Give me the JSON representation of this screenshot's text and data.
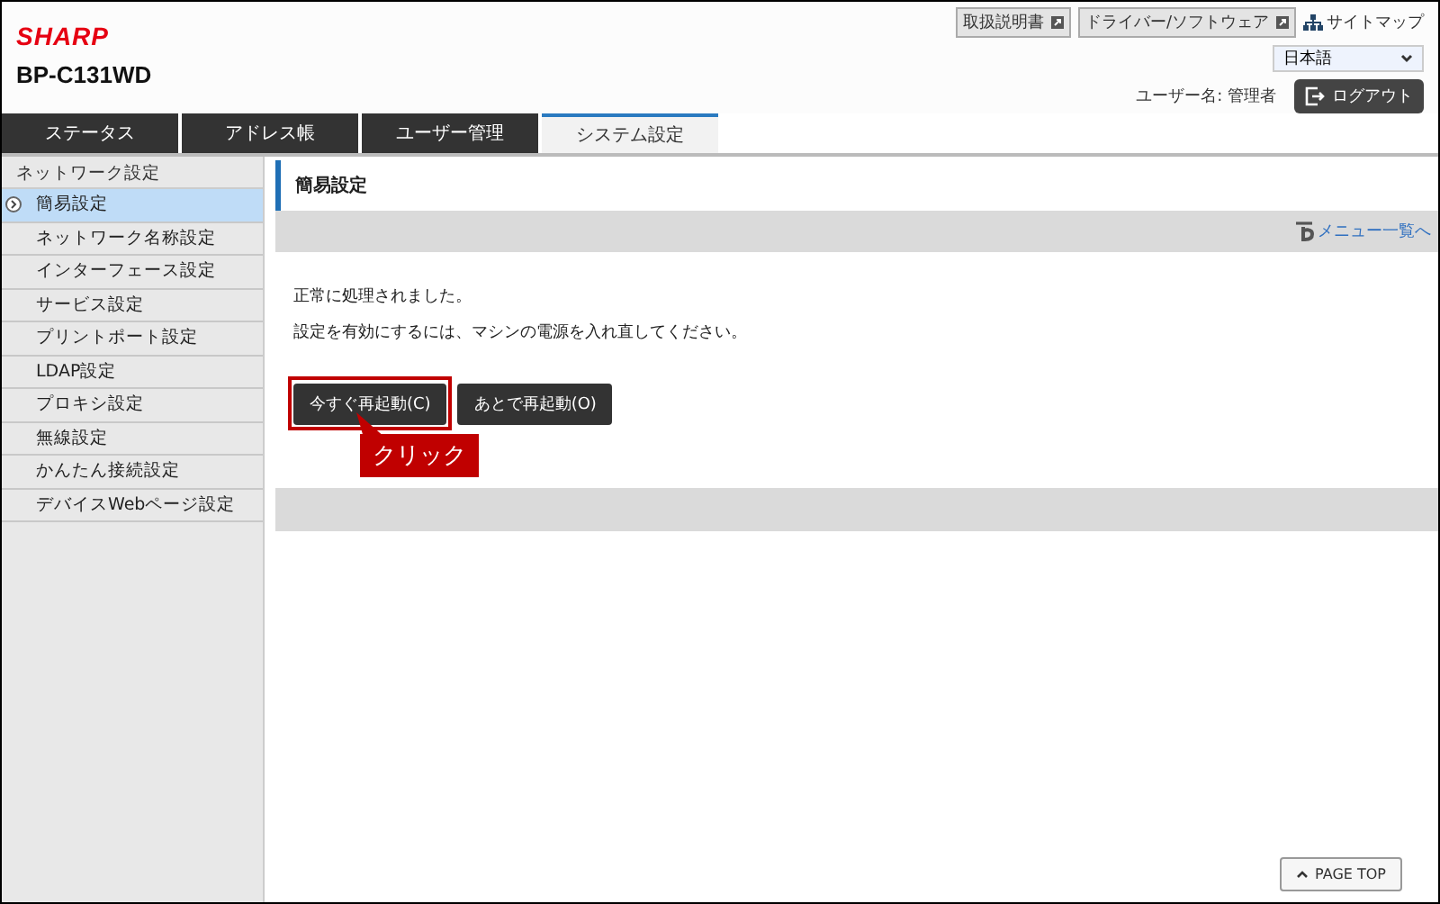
{
  "header": {
    "logo": "SHARP",
    "model": "BP-C131WD",
    "links": [
      {
        "label": "取扱説明書",
        "kind": "external"
      },
      {
        "label": "ドライバー/ソフトウェア",
        "kind": "external"
      },
      {
        "label": "サイトマップ",
        "kind": "sitemap"
      }
    ],
    "language": {
      "value": "日本語"
    },
    "user": "ユーザー名: 管理者",
    "logout": "ログアウト"
  },
  "tabs": [
    {
      "label": "ステータス",
      "selected": false
    },
    {
      "label": "アドレス帳",
      "selected": false
    },
    {
      "label": "ユーザー管理",
      "selected": false
    },
    {
      "label": "システム設定",
      "selected": true
    }
  ],
  "sidebar": {
    "heading": "ネットワーク設定",
    "items": [
      {
        "label": "簡易設定",
        "selected": true
      },
      {
        "label": "ネットワーク名称設定",
        "selected": false
      },
      {
        "label": "インターフェース設定",
        "selected": false
      },
      {
        "label": "サービス設定",
        "selected": false
      },
      {
        "label": "プリントポート設定",
        "selected": false
      },
      {
        "label": "LDAP設定",
        "selected": false
      },
      {
        "label": "プロキシ設定",
        "selected": false
      },
      {
        "label": "無線設定",
        "selected": false
      },
      {
        "label": "かんたん接続設定",
        "selected": false
      },
      {
        "label": "デバイスWebページ設定",
        "selected": false
      }
    ]
  },
  "content": {
    "title": "簡易設定",
    "menu_link": "メニュー一覧へ",
    "messages": [
      "正常に処理されました。",
      "設定を有効にするには、マシンの電源を入れ直してください。"
    ],
    "buttons": [
      {
        "label": "今すぐ再起動(C)",
        "highlighted": true
      },
      {
        "label": "あとで再起動(O)",
        "highlighted": false
      }
    ],
    "callout": "クリック",
    "page_top": "PAGE TOP"
  }
}
